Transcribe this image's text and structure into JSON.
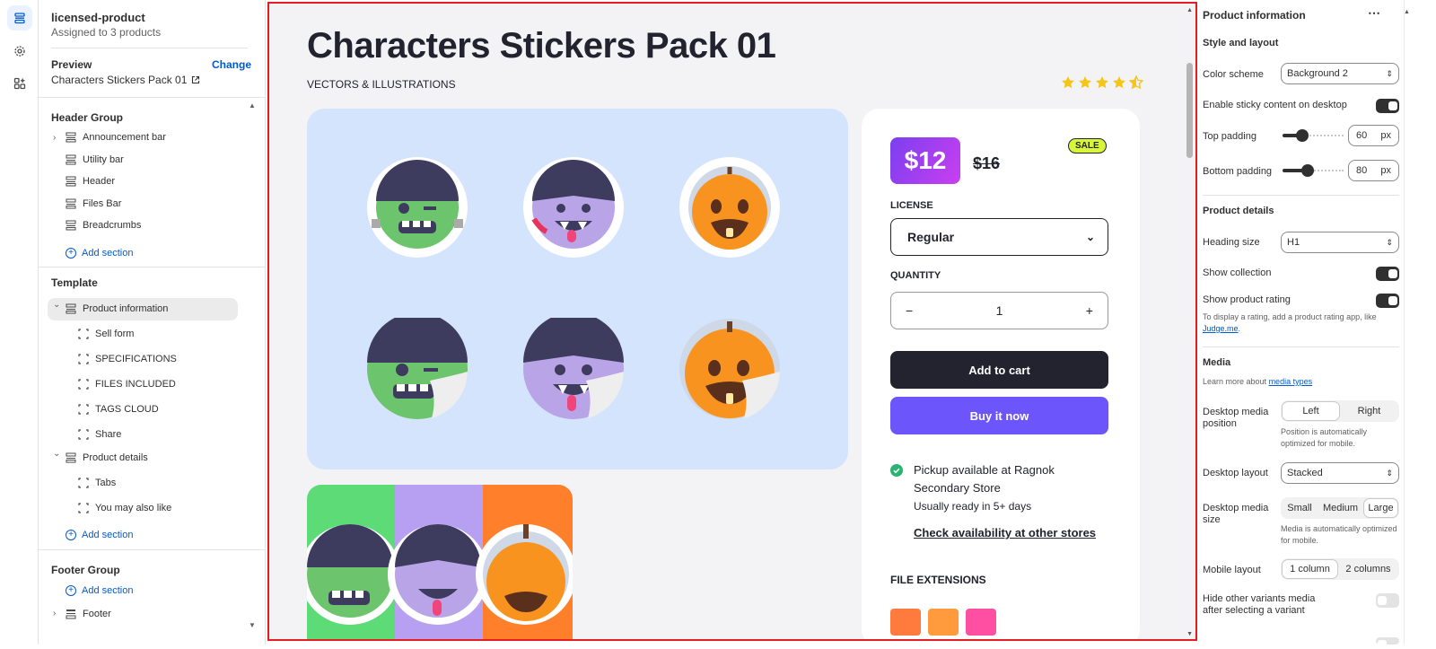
{
  "rail": {
    "items": [
      "sections-icon",
      "settings-gear-icon",
      "apps-icon"
    ]
  },
  "sidebar": {
    "template_name": "licensed-product",
    "assigned": "Assigned to 3 products",
    "preview_label": "Preview",
    "change_label": "Change",
    "preview_value": "Characters Stickers Pack 01",
    "header_group": {
      "title": "Header Group",
      "items": [
        "Announcement bar",
        "Utility bar",
        "Header",
        "Files Bar",
        "Breadcrumbs"
      ],
      "add_section": "Add section"
    },
    "template": {
      "title": "Template",
      "product_information": "Product information",
      "product_information_blocks": [
        "Sell form",
        "SPECIFICATIONS",
        "FILES INCLUDED",
        "TAGS CLOUD",
        "Share"
      ],
      "product_details": "Product details",
      "product_details_blocks": [
        "Tabs",
        "You may also like"
      ],
      "add_section": "Add section"
    },
    "footer_group": {
      "title": "Footer Group",
      "add_section": "Add section",
      "items": [
        "Footer"
      ]
    }
  },
  "preview": {
    "title": "Characters Stickers Pack 01",
    "collection": "VECTORS & ILLUSTRATIONS",
    "rating": 4.5,
    "price": "$12",
    "compare_price": "$16",
    "sale_badge": "SALE",
    "license_label": "LICENSE",
    "license_value": "Regular",
    "quantity_label": "QUANTITY",
    "quantity_value": "1",
    "minus": "−",
    "plus": "+",
    "add_to_cart": "Add to cart",
    "buy_now": "Buy it now",
    "pickup": "Pickup available at Ragnok Secondary Store",
    "pickup_time": "Usually ready in 5+ days",
    "check_availability": "Check availability at other stores",
    "file_extensions": "FILE EXTENSIONS",
    "colors": {
      "media_bg": "#d3e4fc",
      "add_to_cart": "#22232e",
      "buy_now": "#6c55fa",
      "sale_badge": "#d8f53a",
      "star": "#f5c518",
      "check": "#29b473"
    },
    "file_colors": [
      "#ff7a3d",
      "#ff9a3d",
      "#ff4fa3"
    ]
  },
  "settings": {
    "title": "Product information",
    "more": "⋯",
    "style_layout": "Style and layout",
    "color_scheme_label": "Color scheme",
    "color_scheme_value": "Background 2",
    "sticky_label": "Enable sticky content on desktop",
    "sticky_on": true,
    "top_padding_label": "Top padding",
    "top_padding_value": "60",
    "bottom_padding_label": "Bottom padding",
    "bottom_padding_value": "80",
    "unit": "px",
    "product_details": "Product details",
    "heading_size_label": "Heading size",
    "heading_size_value": "H1",
    "show_collection_label": "Show collection",
    "show_collection_on": true,
    "show_rating_label": "Show product rating",
    "show_rating_on": true,
    "rating_help": "To display a rating, add a product rating app, like",
    "rating_help_link": "Judge.me",
    "rating_help_end": ".",
    "media": "Media",
    "media_help": "Learn more about",
    "media_help_link": "media types",
    "media_position_label": "Desktop media position",
    "media_position_options": [
      "Left",
      "Right"
    ],
    "media_position_selected": "Left",
    "media_position_help": "Position is automatically optimized for mobile.",
    "desktop_layout_label": "Desktop layout",
    "desktop_layout_value": "Stacked",
    "media_size_label": "Desktop media size",
    "media_size_options": [
      "Small",
      "Medium",
      "Large"
    ],
    "media_size_selected": "Large",
    "media_size_help": "Media is automatically optimized for mobile.",
    "mobile_layout_label": "Mobile layout",
    "mobile_layout_options": [
      "1 column",
      "2 columns"
    ],
    "mobile_layout_selected": "1 column",
    "hide_variants_label": "Hide other variants media after selecting a variant",
    "hide_variants_on": false
  }
}
